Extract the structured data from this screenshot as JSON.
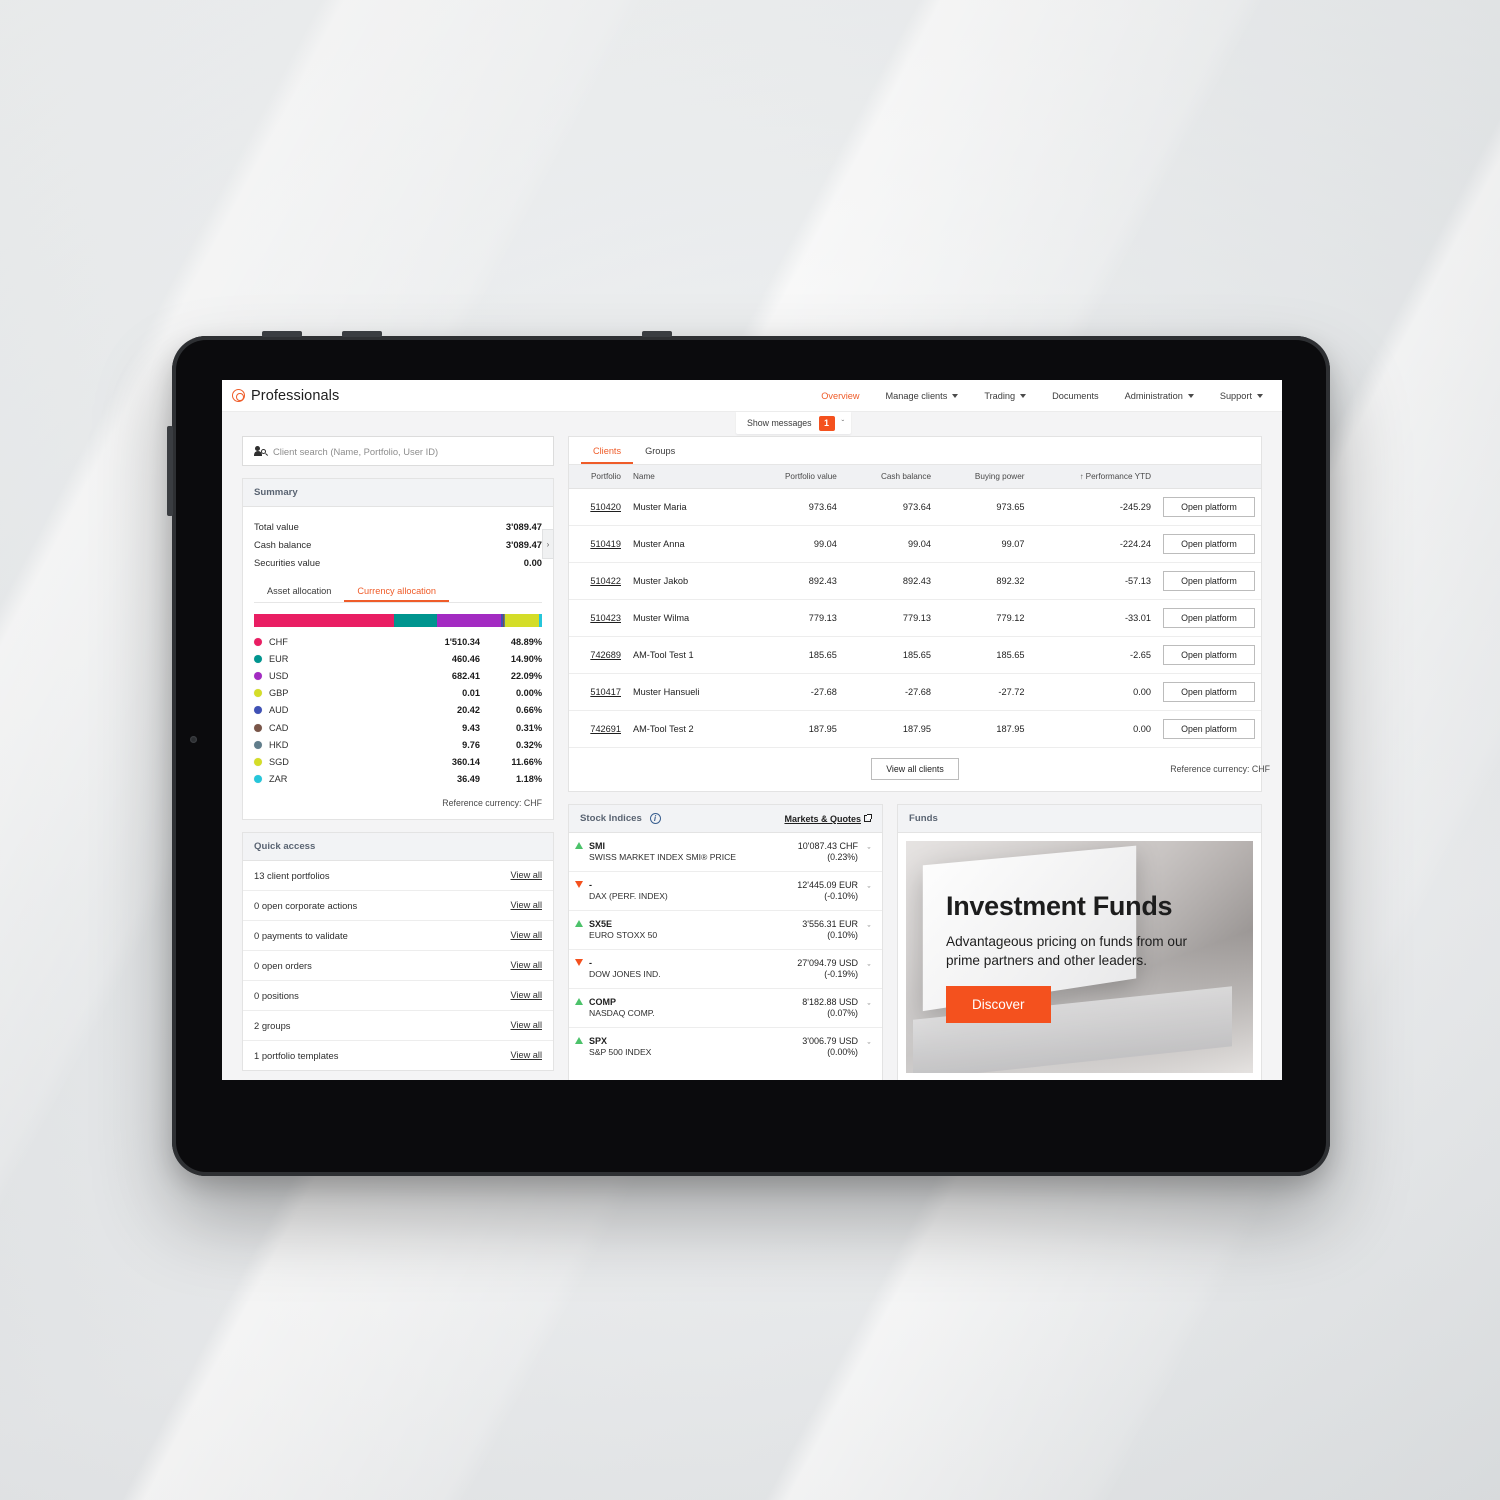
{
  "app": {
    "brand": "Professionals",
    "nav": [
      {
        "label": "Overview",
        "caret": false,
        "active": true
      },
      {
        "label": "Manage clients",
        "caret": true,
        "active": false
      },
      {
        "label": "Trading",
        "caret": true,
        "active": false
      },
      {
        "label": "Documents",
        "caret": false,
        "active": false
      },
      {
        "label": "Administration",
        "caret": true,
        "active": false
      },
      {
        "label": "Support",
        "caret": true,
        "active": false
      }
    ],
    "messages": {
      "label": "Show messages",
      "count": "1",
      "chevron": "ˇ"
    }
  },
  "search": {
    "placeholder": "Client search (Name, Portfolio, User ID)",
    "value": ""
  },
  "summary": {
    "title": "Summary",
    "rows": [
      {
        "label": "Total value",
        "value": "3'089.47"
      },
      {
        "label": "Cash balance",
        "value": "3'089.47"
      },
      {
        "label": "Securities value",
        "value": "0.00"
      }
    ],
    "next_arrow": "›",
    "tabs": [
      {
        "label": "Asset allocation",
        "active": false
      },
      {
        "label": "Currency allocation",
        "active": true
      }
    ],
    "reference_currency": "Reference currency: CHF",
    "allocation": [
      {
        "currency": "CHF",
        "amount": "1'510.34",
        "percent": "48.89%",
        "pct": 48.89,
        "color": "#e91e63"
      },
      {
        "currency": "EUR",
        "amount": "460.46",
        "percent": "14.90%",
        "pct": 14.9,
        "color": "#00958f"
      },
      {
        "currency": "USD",
        "amount": "682.41",
        "percent": "22.09%",
        "pct": 22.09,
        "color": "#a32bc2"
      },
      {
        "currency": "GBP",
        "amount": "0.01",
        "percent": "0.00%",
        "pct": 0.3,
        "color": "#d4dd28"
      },
      {
        "currency": "AUD",
        "amount": "20.42",
        "percent": "0.66%",
        "pct": 0.66,
        "color": "#3f51b5"
      },
      {
        "currency": "CAD",
        "amount": "9.43",
        "percent": "0.31%",
        "pct": 0.31,
        "color": "#795548"
      },
      {
        "currency": "HKD",
        "amount": "9.76",
        "percent": "0.32%",
        "pct": 0.32,
        "color": "#607d8b"
      },
      {
        "currency": "SGD",
        "amount": "360.14",
        "percent": "11.66%",
        "pct": 11.66,
        "color": "#d4dd28"
      },
      {
        "currency": "ZAR",
        "amount": "36.49",
        "percent": "1.18%",
        "pct": 1.18,
        "color": "#26c6da"
      }
    ]
  },
  "quick_access": {
    "title": "Quick access",
    "link_label": "View all",
    "items": [
      {
        "label": "13 client portfolios"
      },
      {
        "label": "0 open corporate actions"
      },
      {
        "label": "0 payments to validate"
      },
      {
        "label": "0 open orders"
      },
      {
        "label": "0 positions"
      },
      {
        "label": "2 groups"
      },
      {
        "label": "1 portfolio templates"
      }
    ]
  },
  "clients": {
    "tabs": [
      {
        "label": "Clients",
        "active": true
      },
      {
        "label": "Groups",
        "active": false
      }
    ],
    "columns": [
      "Portfolio",
      "Name",
      "Portfolio value",
      "Cash balance",
      "Buying power",
      "Performance YTD"
    ],
    "sort_arrow": "↑",
    "sorted_column": "Performance YTD",
    "open_button_label": "Open platform",
    "view_all_label": "View all clients",
    "reference_currency": "Reference currency: CHF",
    "rows": [
      {
        "portfolio": "510420",
        "name": "Muster Maria",
        "portfolio_value": "973.64",
        "cash_balance": "973.64",
        "buying_power": "973.65",
        "performance_ytd": "-245.29"
      },
      {
        "portfolio": "510419",
        "name": "Muster Anna",
        "portfolio_value": "99.04",
        "cash_balance": "99.04",
        "buying_power": "99.07",
        "performance_ytd": "-224.24"
      },
      {
        "portfolio": "510422",
        "name": "Muster Jakob",
        "portfolio_value": "892.43",
        "cash_balance": "892.43",
        "buying_power": "892.32",
        "performance_ytd": "-57.13"
      },
      {
        "portfolio": "510423",
        "name": "Muster Wilma",
        "portfolio_value": "779.13",
        "cash_balance": "779.13",
        "buying_power": "779.12",
        "performance_ytd": "-33.01"
      },
      {
        "portfolio": "742689",
        "name": "AM-Tool Test 1",
        "portfolio_value": "185.65",
        "cash_balance": "185.65",
        "buying_power": "185.65",
        "performance_ytd": "-2.65"
      },
      {
        "portfolio": "510417",
        "name": "Muster Hansueli",
        "portfolio_value": "-27.68",
        "cash_balance": "-27.68",
        "buying_power": "-27.72",
        "performance_ytd": "0.00"
      },
      {
        "portfolio": "742691",
        "name": "AM-Tool Test 2",
        "portfolio_value": "187.95",
        "cash_balance": "187.95",
        "buying_power": "187.95",
        "performance_ytd": "0.00"
      }
    ]
  },
  "stock_indices": {
    "title": "Stock Indices",
    "info_glyph": "i",
    "link_label": "Markets & Quotes",
    "chevron": "ˇ",
    "rows": [
      {
        "direction": "up",
        "symbol": "SMI",
        "name": "SWISS MARKET INDEX SMI® PRICE",
        "price": "10'087.43 CHF",
        "change": "(0.23%)"
      },
      {
        "direction": "down",
        "symbol": "-",
        "name": "DAX (PERF. INDEX)",
        "price": "12'445.09 EUR",
        "change": "(-0.10%)"
      },
      {
        "direction": "up",
        "symbol": "SX5E",
        "name": "EURO STOXX 50",
        "price": "3'556.31 EUR",
        "change": "(0.10%)"
      },
      {
        "direction": "down",
        "symbol": "-",
        "name": "DOW JONES IND.",
        "price": "27'094.79 USD",
        "change": "(-0.19%)"
      },
      {
        "direction": "up",
        "symbol": "COMP",
        "name": "NASDAQ COMP.",
        "price": "8'182.88 USD",
        "change": "(0.07%)"
      },
      {
        "direction": "up",
        "symbol": "SPX",
        "name": "S&P 500 INDEX",
        "price": "3'006.79 USD",
        "change": "(0.00%)"
      }
    ]
  },
  "funds": {
    "title": "Funds",
    "banner_title": "Investment Funds",
    "banner_subtitle": "Advantageous pricing on funds from our prime partners and other leaders.",
    "button_label": "Discover"
  },
  "colors": {
    "accent": "#ef5c29",
    "badge": "#f4511e",
    "up": "#4cc26a",
    "down": "#f4511e"
  }
}
